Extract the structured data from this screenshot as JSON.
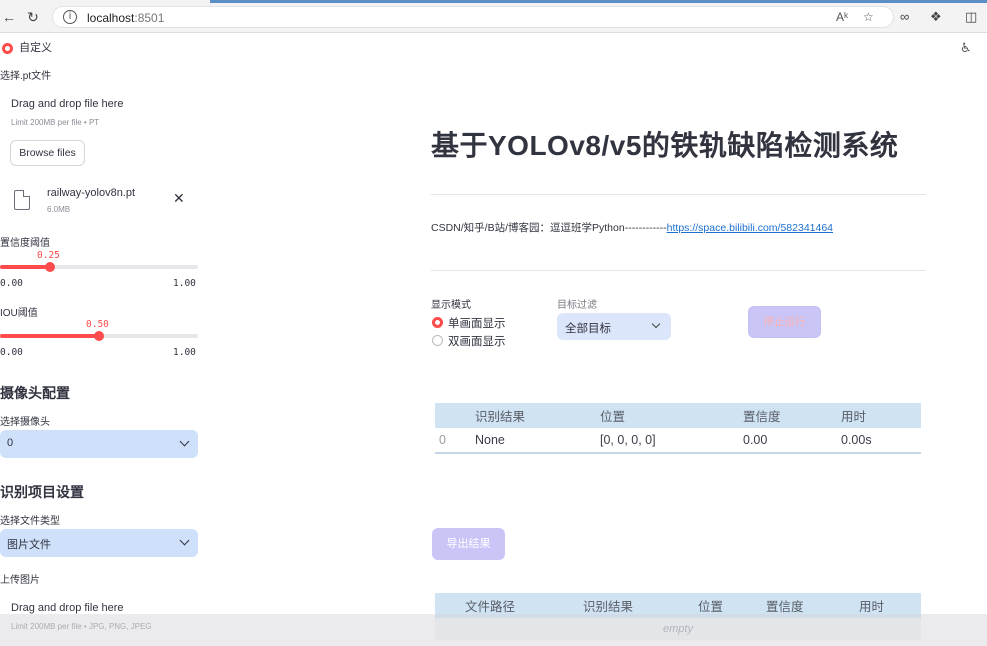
{
  "browser": {
    "url_host": "localhost",
    "url_port": ":8501",
    "accent_color": "#5b8fc7"
  },
  "sidebar": {
    "custom_model_label": "自定义",
    "pt_file_label": "选择.pt文件",
    "uploader1": {
      "title": "Drag and drop file here",
      "limit": "Limit 200MB per file • PT",
      "browse": "Browse files",
      "file_name": "railway-yolov8n.pt",
      "file_size": "6.0MB"
    },
    "conf": {
      "label": "置信度阈值",
      "value": "0.25",
      "min": "0.00",
      "max": "1.00",
      "fraction": 0.25
    },
    "iou": {
      "label": "IOU阈值",
      "value": "0.50",
      "min": "0.00",
      "max": "1.00",
      "fraction": 0.5
    },
    "camera_header": "摄像头配置",
    "camera_label": "选择摄像头",
    "camera_value": "0",
    "recog_header": "识别项目设置",
    "filetype_label": "选择文件类型",
    "filetype_value": "图片文件",
    "upload_image_label": "上传图片",
    "uploader2": {
      "title": "Drag and drop file here",
      "limit": "Limit 200MB per file • JPG, PNG, JPEG"
    }
  },
  "main": {
    "title": "基于YOLOv8/v5的铁轨缺陷检测系统",
    "credit_prefix": "CSDN/知乎/B站/博客园：逗逗班学Python------------",
    "credit_link": "https://space.bilibili.com/582341464",
    "display_mode_label": "显示模式",
    "display_options": [
      "单画面显示",
      "双画面显示"
    ],
    "target_filter_label": "目标过滤",
    "target_filter_value": "全部目标",
    "stop_button": "停止运行",
    "result_table": {
      "headers": [
        "",
        "识别结果",
        "位置",
        "置信度",
        "用时"
      ],
      "row": [
        "0",
        "None",
        "[0, 0, 0, 0]",
        "0.00",
        "0.00s"
      ]
    },
    "export_button": "导出结果",
    "log_table": {
      "headers": [
        "",
        "文件路径",
        "识别结果",
        "位置",
        "置信度",
        "用时"
      ],
      "empty": "empty"
    }
  },
  "colors": {
    "primary_red": "#ff4b4b",
    "select_bg": "#cfe0fb",
    "table_header_bg": "#cfe3f3",
    "button_purple": "#c9c6f7"
  }
}
